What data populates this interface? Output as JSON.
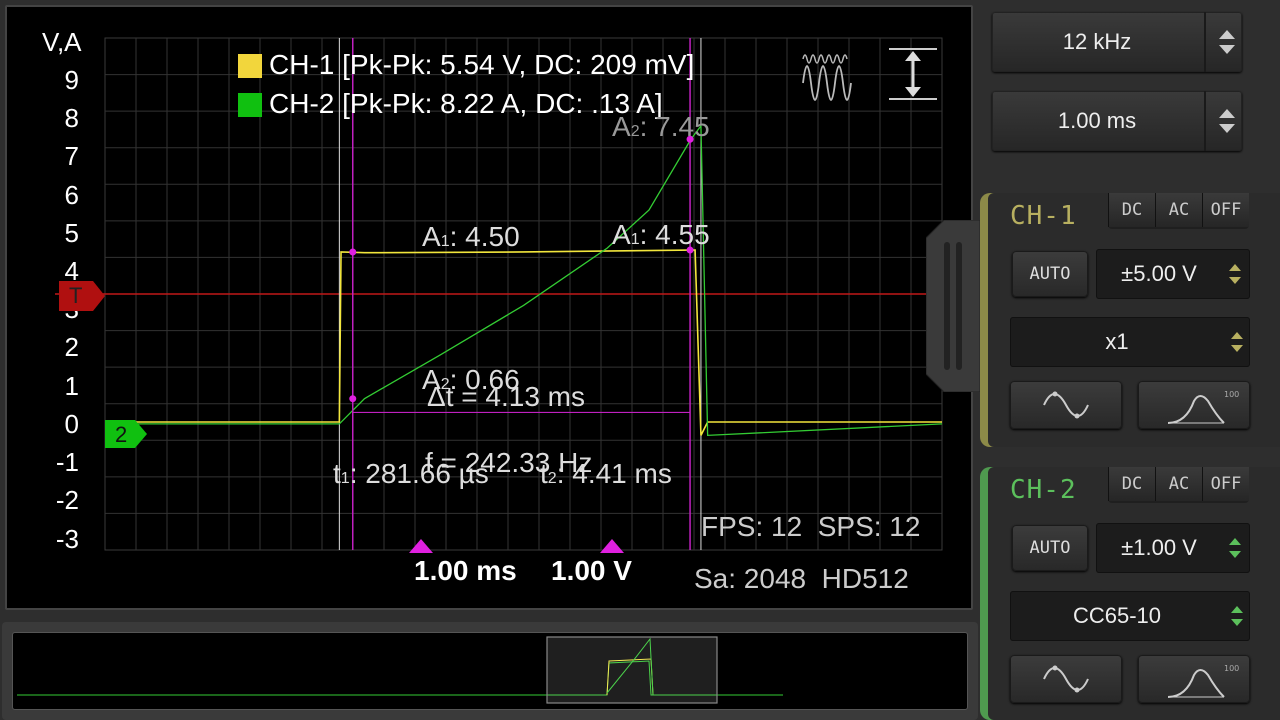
{
  "chart_data": {
    "type": "line",
    "title": "",
    "ylabel": "V,A",
    "y_ticks": [
      "9",
      "8",
      "7",
      "6",
      "5",
      "4",
      "3",
      "2",
      "1",
      "0",
      "-1",
      "-2",
      "-3"
    ],
    "ylim": [
      -3.3,
      10.1
    ],
    "xlim_ms": [
      0,
      10
    ],
    "grid": true,
    "legend_position": "top-left",
    "series": [
      {
        "name": "CH-1 [Pk-Pk: 5.54 V, DC: 209 mV]",
        "color": "#f2e63c",
        "x": [
          0,
          2.8,
          2.82,
          3.1,
          5.0,
          7.0,
          7.05,
          7.12,
          7.2,
          10
        ],
        "y": [
          0.05,
          0.05,
          4.5,
          4.48,
          4.5,
          4.55,
          4.55,
          -0.3,
          0.05,
          0.05
        ]
      },
      {
        "name": "CH-2 [Pk-Pk: 8.22 A, DC: .13 A]",
        "color": "#33cc33",
        "x": [
          0,
          2.8,
          3.1,
          4.0,
          5.0,
          6.0,
          6.5,
          7.0,
          7.12,
          7.2,
          10
        ],
        "y": [
          0,
          0,
          0.66,
          1.8,
          3.1,
          4.6,
          5.6,
          7.45,
          7.8,
          -0.3,
          0
        ]
      }
    ]
  },
  "axis": {
    "unit_label": "V,A"
  },
  "legend": {
    "ch1": "CH-1 [Pk-Pk: 5.54 V, DC: 209 mV]",
    "ch2": "CH-2 [Pk-Pk: 8.22 A, DC: .13 A]"
  },
  "markers": {
    "trigger": "T",
    "ch2_ground": "2",
    "a2_top": "7.45",
    "a1_left": "4.50",
    "a1_right": "4.55",
    "a2_bottom": "0.66",
    "delta_t": "Δt = 4.13 ms",
    "freq": "f = 242.33 Hz",
    "t1": "281.66 µs",
    "t2": "4.41 ms",
    "a_sym": "A",
    "t_sym": "t"
  },
  "status": {
    "fps": "FPS: 12  SPS: 12",
    "sa": "Sa: 2048  HD512",
    "timebase": "1.00 ms",
    "voltsdiv": "1.00 V"
  },
  "controls": {
    "sample_rate": "12 kHz",
    "time_div": "1.00 ms"
  },
  "ch1": {
    "title": "CH-1",
    "coupling": [
      "DC",
      "AC",
      "OFF"
    ],
    "auto": "AUTO",
    "range": "±5.00 V",
    "probe": "x1",
    "accent": "#9a9a4a"
  },
  "ch2": {
    "title": "CH-2",
    "coupling": [
      "DC",
      "AC",
      "OFF"
    ],
    "auto": "AUTO",
    "range": "±1.00 V",
    "probe": "CC65-10",
    "accent": "#5aaa5a"
  }
}
